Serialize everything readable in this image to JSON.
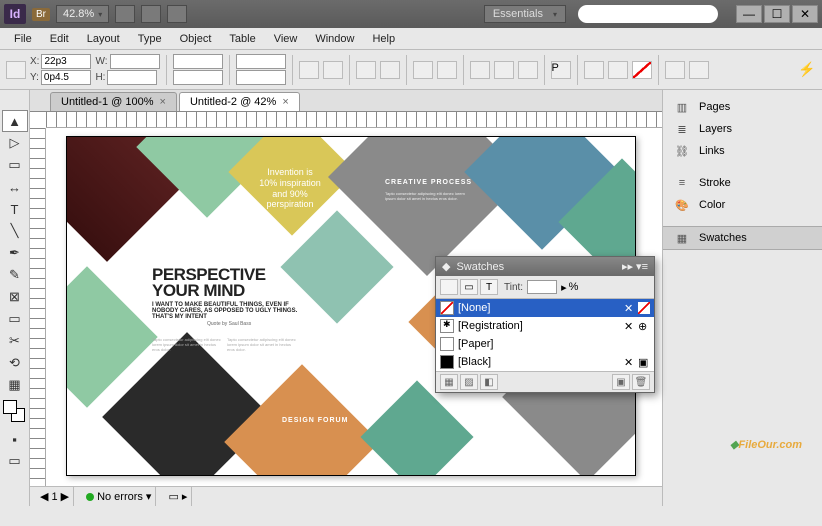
{
  "titlebar": {
    "app_badge": "Id",
    "br_badge": "Br",
    "zoom": "42.8%",
    "workspace": "Essentials",
    "win": {
      "min": "—",
      "max": "☐",
      "close": "✕"
    }
  },
  "menu": [
    "File",
    "Edit",
    "Layout",
    "Type",
    "Object",
    "Table",
    "View",
    "Window",
    "Help"
  ],
  "controlbar": {
    "x_label": "X:",
    "x_value": "22p3",
    "y_label": "Y:",
    "y_value": "0p4.5",
    "w_label": "W:",
    "w_value": "",
    "h_label": "H:",
    "h_value": ""
  },
  "tabs": [
    {
      "label": "Untitled-1 @ 100%",
      "active": false
    },
    {
      "label": "Untitled-2 @ 42%",
      "active": true
    }
  ],
  "document": {
    "invention": "Invention is\n10% inspiration\nand 90%\nperspiration",
    "creative_title": "CREATIVE PROCESS",
    "headline1": "PERSPECTIVE",
    "headline2": "YOUR MIND",
    "subhead": "I WANT TO MAKE BEAUTIFUL THINGS, EVEN IF NOBODY CARES, AS OPPOSED TO UGLY THINGS. THAT'S MY INTENT",
    "quote": "Quote by Saul Bass",
    "design_forum": "DESIGN FORUM",
    "lorem": "Tapto consectetur adipiscing elit donec lorem ipsum dolor sit amet in hectus eros dolor."
  },
  "statusbar": {
    "page": "1",
    "preflight": "No errors"
  },
  "panels": {
    "items": [
      "Pages",
      "Layers",
      "Links",
      "Stroke",
      "Color",
      "Swatches"
    ]
  },
  "swatches": {
    "title": "Swatches",
    "tint_label": "Tint:",
    "tint_suffix": "%",
    "rows": [
      {
        "name": "[None]",
        "type": "none",
        "selected": true
      },
      {
        "name": "[Registration]",
        "type": "reg",
        "selected": false
      },
      {
        "name": "[Paper]",
        "type": "paper",
        "selected": false
      },
      {
        "name": "[Black]",
        "type": "black",
        "selected": false
      }
    ]
  },
  "watermark": "FileOur.com"
}
